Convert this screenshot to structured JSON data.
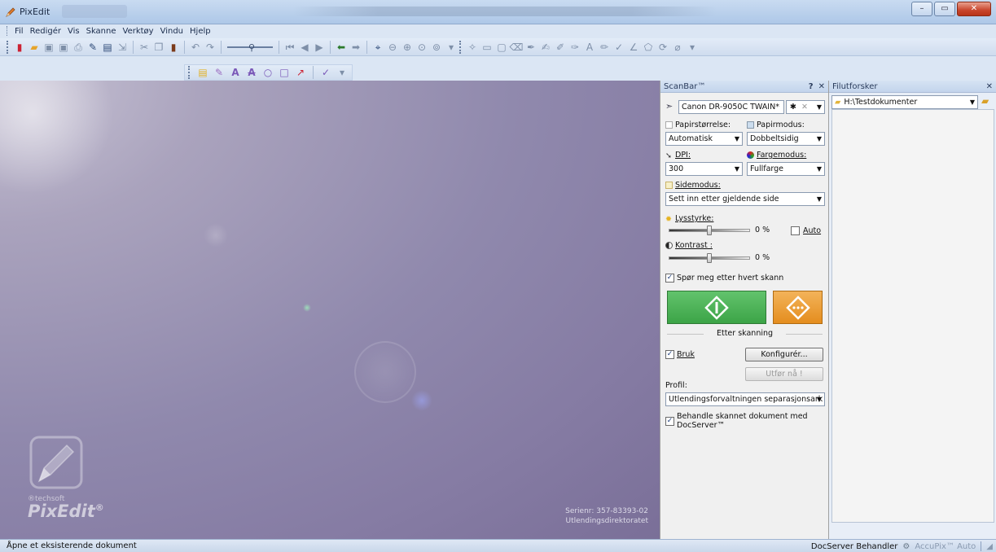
{
  "window": {
    "title": "PixEdit",
    "controls": {
      "minimize": "–",
      "maximize": "▭",
      "close": "✕"
    }
  },
  "menu": [
    "Fil",
    "Redigér",
    "Vis",
    "Skanne",
    "Verktøy",
    "Vindu",
    "Hjelp"
  ],
  "workspace": {
    "watermark_brand": "®techsoft",
    "watermark_name": "PixEdit",
    "serial_line1": "Serienr: 357-83393-02",
    "serial_line2": "Utlendingsdirektoratet"
  },
  "scanbar": {
    "title": "ScanBar™",
    "help": "?",
    "close": "✕",
    "scanner": "Canon DR-9050C TWAIN*",
    "paper_size_label": "Papirstørrelse:",
    "paper_size_value": "Automatisk",
    "paper_mode_label": "Papirmodus:",
    "paper_mode_value": "Dobbeltsidig",
    "dpi_label": "DPI:",
    "dpi_value": "300",
    "color_mode_label": "Fargemodus:",
    "color_mode_value": "Fullfarge",
    "page_mode_label": "Sidemodus:",
    "page_mode_value": "Sett inn etter gjeldende side",
    "brightness_label": "Lysstyrke:",
    "brightness_value": "0 %",
    "brightness_level": 0,
    "auto_label": "Auto",
    "contrast_label": "Kontrast :",
    "contrast_value": "0 %",
    "contrast_level": 0,
    "ask_each_scan": "Spør meg etter hvert skann",
    "after_scan_title": "Etter skanning",
    "use_label": "Bruk",
    "configure_label": "Konfigurér...",
    "execute_now_label": "Utfør nå !",
    "profile_label": "Profil:",
    "profile_value": "Utlendingsforvaltningen separasjonsark",
    "docserver_line1": "Behandle skannet dokument med",
    "docserver_line2": "DocServer™",
    "accent_green": "#3ca447",
    "accent_orange": "#e48d1e"
  },
  "explorer": {
    "title": "Filutforsker",
    "close": "✕",
    "path": "H:\\Testdokumenter"
  },
  "status": {
    "left": "Åpne et eksisterende dokument",
    "docserver": "DocServer Behandler",
    "accupix": "AccuPix™ Auto"
  }
}
